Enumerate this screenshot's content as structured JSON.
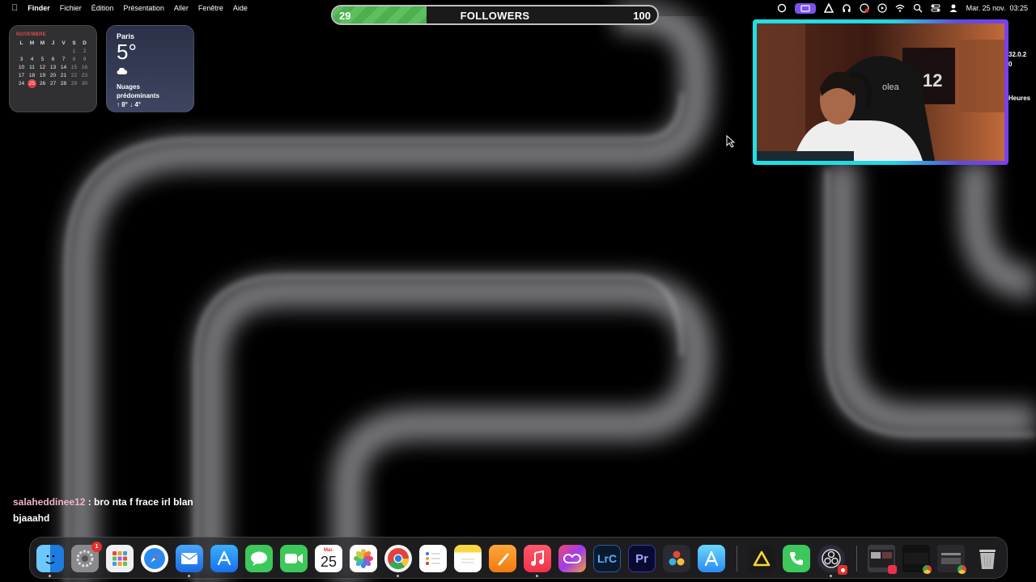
{
  "menubar": {
    "apple_icon": "apple-icon",
    "items": [
      "Finder",
      "Fichier",
      "Édition",
      "Présentation",
      "Aller",
      "Fenêtre",
      "Aide"
    ],
    "datetime": "Mar. 25 nov.  03:25"
  },
  "followers_goal": {
    "title": "FOLLOWERS",
    "current": "29",
    "goal": "100",
    "progress_fraction": 0.29
  },
  "calendar": {
    "month": "NOVEMBRE",
    "weekdays": [
      "L",
      "M",
      "M",
      "J",
      "V",
      "S",
      "D"
    ],
    "today": "25"
  },
  "weather": {
    "city": "Paris",
    "temp": "5°",
    "condition_line1": "Nuages",
    "condition_line2": "prédominants",
    "range": "↑ 8° ↓ 4°"
  },
  "side_text": {
    "line1": "32.0.2",
    "line2": "0",
    "line3": "Heures"
  },
  "chat": {
    "user": "salaheddinee12",
    "message": " : bro nta f frace irl blan bjaaahd"
  },
  "dock": {
    "settings_badge": "1",
    "calendar_day_label": "Mar.",
    "calendar_day": "25",
    "lightroom_label": "LrC",
    "premiere_label": "Pr",
    "apps": [
      "Finder",
      "Réglages Système",
      "Launchpad",
      "Safari",
      "Mail",
      "App Store",
      "Messages",
      "FaceTime",
      "Calendrier",
      "Photos",
      "Chrome",
      "Rappels",
      "Notes",
      "Pages",
      "Musique",
      "Creative Cloud",
      "Lightroom Classic",
      "Premiere Pro",
      "DaVinci Resolve",
      "Xcode",
      "Altium",
      "Téléphone",
      "OBS",
      "Corbeille"
    ]
  },
  "colors": {
    "accent": "#7a52f0",
    "progress": "#4caf50",
    "webcam_border_left": "#22e0e6",
    "webcam_border_right": "#7b3ff0"
  }
}
